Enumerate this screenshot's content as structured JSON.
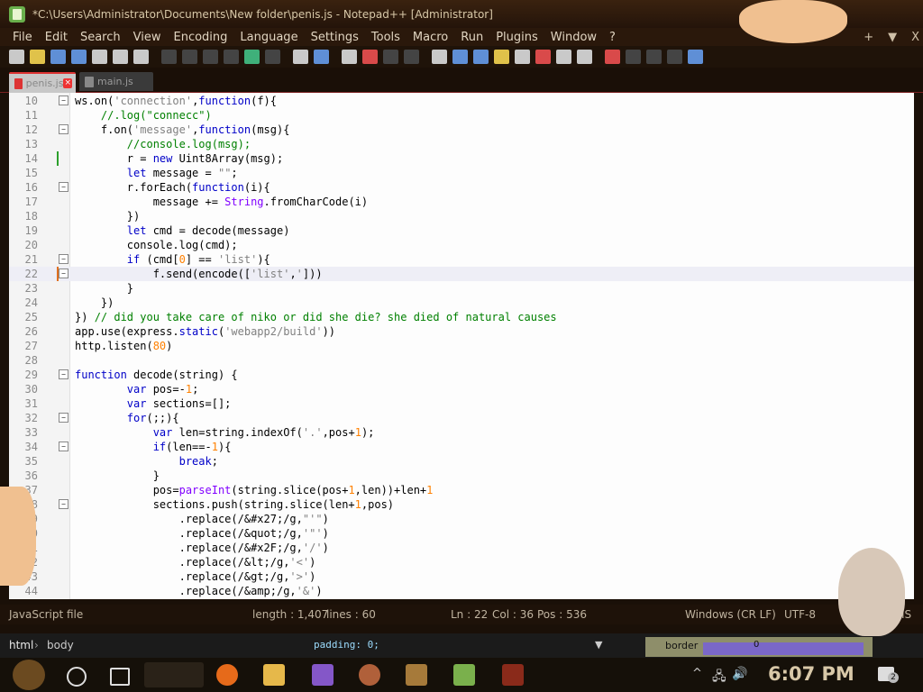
{
  "window": {
    "title": "*C:\\Users\\Administrator\\Documents\\New folder\\penis.js - Notepad++ [Administrator]"
  },
  "menu": [
    "File",
    "Edit",
    "Search",
    "View",
    "Encoding",
    "Language",
    "Settings",
    "Tools",
    "Macro",
    "Run",
    "Plugins",
    "Window",
    "?"
  ],
  "menu_right": {
    "plus": "+",
    "arrow": "▼",
    "close": "X"
  },
  "tabs": [
    {
      "label": "penis.js",
      "active": true
    },
    {
      "label": "main.js",
      "active": false
    }
  ],
  "editor": {
    "current_line": 22,
    "lines": [
      {
        "n": "10",
        "fold": true,
        "mark": "",
        "html": "ws.on(<span class='s'>'connection'</span>,<span class='k'>function</span>(f){"
      },
      {
        "n": "11",
        "fold": false,
        "mark": "",
        "html": "    <span class='c'>//.log(\"connecc\")</span>"
      },
      {
        "n": "12",
        "fold": true,
        "mark": "",
        "html": "    f.on(<span class='s'>'message'</span>,<span class='k'>function</span>(msg){"
      },
      {
        "n": "13",
        "fold": false,
        "mark": "",
        "html": "        <span class='c'>//console.log(msg);</span>"
      },
      {
        "n": "14",
        "fold": false,
        "mark": "g",
        "html": "        r = <span class='k'>new</span> Uint8Array(msg);"
      },
      {
        "n": "15",
        "fold": false,
        "mark": "",
        "html": "        <span class='k'>let</span> message = <span class='s'>\"\"</span>;"
      },
      {
        "n": "16",
        "fold": true,
        "mark": "",
        "html": "        r.forEach(<span class='k'>function</span>(i){"
      },
      {
        "n": "17",
        "fold": false,
        "mark": "",
        "html": "            message += <span class='bl'>String</span>.fromCharCode(i)"
      },
      {
        "n": "18",
        "fold": false,
        "mark": "",
        "html": "        })"
      },
      {
        "n": "19",
        "fold": false,
        "mark": "",
        "html": "        <span class='k'>let</span> cmd = decode(message)"
      },
      {
        "n": "20",
        "fold": false,
        "mark": "",
        "html": "        console.log(cmd);"
      },
      {
        "n": "21",
        "fold": true,
        "mark": "",
        "html": "        <span class='k'>if</span> (cmd[<span class='n'>0</span>] == <span class='s'>'list'</span>){"
      },
      {
        "n": "22",
        "fold": true,
        "mark": "o",
        "html": "            f.send(encode([<span class='s'>'list'</span>,<span class='s'>'</span>]))"
      },
      {
        "n": "23",
        "fold": false,
        "mark": "",
        "html": "        }"
      },
      {
        "n": "24",
        "fold": false,
        "mark": "",
        "html": "    })"
      },
      {
        "n": "25",
        "fold": false,
        "mark": "",
        "html": "}) <span class='c'>// did you take care of niko or did she die? she died of natural causes</span>"
      },
      {
        "n": "26",
        "fold": false,
        "mark": "",
        "html": "app.use(express.<span class='k'>static</span>(<span class='s'>'webapp2/build'</span>))"
      },
      {
        "n": "27",
        "fold": false,
        "mark": "",
        "html": "http.listen(<span class='n'>80</span>)"
      },
      {
        "n": "28",
        "fold": false,
        "mark": "",
        "html": ""
      },
      {
        "n": "29",
        "fold": true,
        "mark": "",
        "html": "<span class='k'>function</span> decode(string) {"
      },
      {
        "n": "30",
        "fold": false,
        "mark": "",
        "html": "        <span class='k'>var</span> pos=-<span class='n'>1</span>;"
      },
      {
        "n": "31",
        "fold": false,
        "mark": "",
        "html": "        <span class='k'>var</span> sections=[];"
      },
      {
        "n": "32",
        "fold": true,
        "mark": "",
        "html": "        <span class='k'>for</span>(;;){"
      },
      {
        "n": "33",
        "fold": false,
        "mark": "",
        "html": "            <span class='k'>var</span> len=string.indexOf(<span class='s'>'.'</span>,pos+<span class='n'>1</span>);"
      },
      {
        "n": "34",
        "fold": true,
        "mark": "",
        "html": "            <span class='k'>if</span>(len==-<span class='n'>1</span>){"
      },
      {
        "n": "35",
        "fold": false,
        "mark": "",
        "html": "                <span class='k'>break</span>;"
      },
      {
        "n": "36",
        "fold": false,
        "mark": "",
        "html": "            }"
      },
      {
        "n": "37",
        "fold": false,
        "mark": "",
        "html": "            pos=<span class='bl'>parseInt</span>(string.slice(pos+<span class='n'>1</span>,len))+len+<span class='n'>1</span>"
      },
      {
        "n": "38",
        "fold": true,
        "mark": "",
        "html": "            sections.push(string.slice(len+<span class='n'>1</span>,pos)"
      },
      {
        "n": "39",
        "fold": false,
        "mark": "",
        "html": "                .replace(/&amp;#x27;/g,<span class='s'>\"'\"</span>)"
      },
      {
        "n": "40",
        "fold": false,
        "mark": "",
        "html": "                .replace(/&amp;quot;/g,<span class='s'>'\"'</span>)"
      },
      {
        "n": "41",
        "fold": false,
        "mark": "",
        "html": "                .replace(/&amp;#x2F;/g,<span class='s'>'/'</span>)"
      },
      {
        "n": "42",
        "fold": false,
        "mark": "",
        "html": "                .replace(/&amp;lt;/g,<span class='s'>'&lt;'</span>)"
      },
      {
        "n": "43",
        "fold": false,
        "mark": "",
        "html": "                .replace(/&amp;gt;/g,<span class='s'>'&gt;'</span>)"
      },
      {
        "n": "44",
        "fold": false,
        "mark": "",
        "html": "                .replace(/&amp;amp;/g,<span class='s'>'&amp;'</span>)"
      }
    ]
  },
  "status": {
    "file_type": "JavaScript file",
    "length": "length : 1,407",
    "lines": "lines : 60",
    "ln": "Ln : 22",
    "col": "Col : 36",
    "pos": "Pos : 536",
    "eol": "Windows (CR LF)",
    "encoding": "UTF-8",
    "mode": "IS"
  },
  "devtools": {
    "crumb1": "html",
    "sep": "›",
    "crumb2": "body",
    "padding_line": "padding: 0;",
    "box_label": "border",
    "box_value": "0"
  },
  "taskbar": {
    "clock": "6:07 PM",
    "notif": "2"
  }
}
